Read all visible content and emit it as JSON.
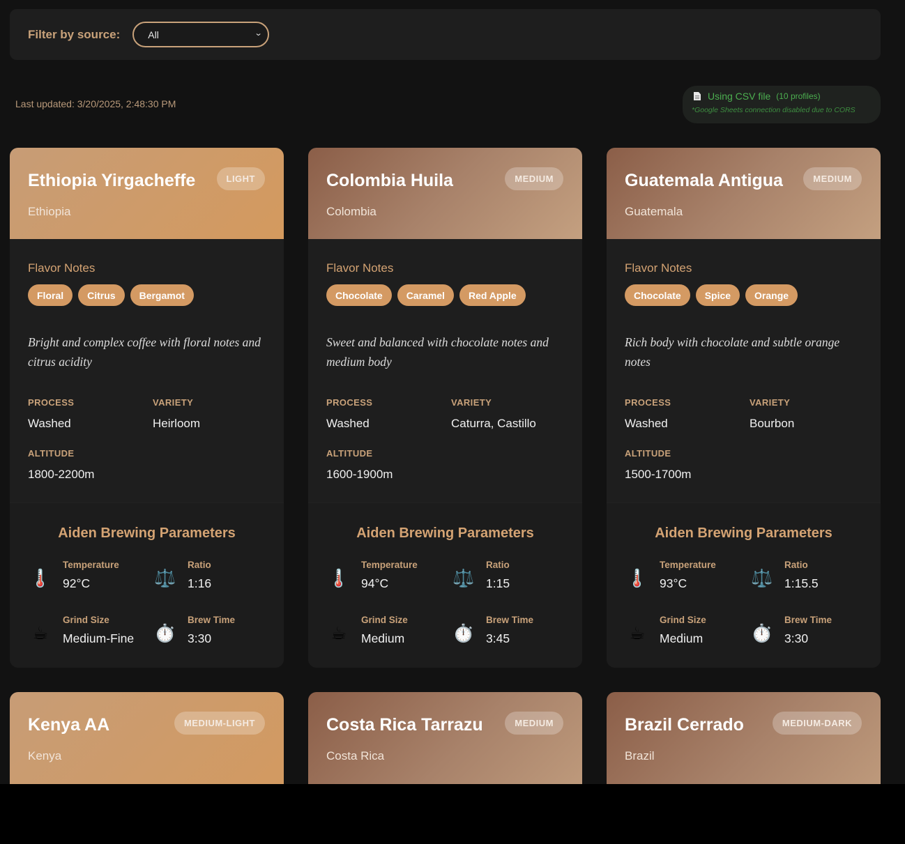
{
  "filter": {
    "label": "Filter by source:",
    "selected": "All"
  },
  "last_updated": "Last updated: 3/20/2025, 2:48:30 PM",
  "status": {
    "main": "Using CSV file",
    "count": "(10 profiles)",
    "note": "*Google Sheets connection disabled due to CORS"
  },
  "labels": {
    "flavor_notes": "Flavor Notes",
    "process": "PROCESS",
    "variety": "VARIETY",
    "altitude": "ALTITUDE",
    "brewing_title": "Aiden Brewing Parameters",
    "temperature": "Temperature",
    "ratio": "Ratio",
    "grind_size": "Grind Size",
    "brew_time": "Brew Time"
  },
  "cards": [
    {
      "name": "Ethiopia Yirgacheffe",
      "country": "Ethiopia",
      "roast": "LIGHT",
      "flavors": [
        "Floral",
        "Citrus",
        "Bergamot"
      ],
      "description": "Bright and complex coffee with floral notes and citrus acidity",
      "process": "Washed",
      "variety": "Heirloom",
      "altitude": "1800-2200m",
      "temperature": "92°C",
      "ratio": "1:16",
      "grind": "Medium-Fine",
      "time": "3:30"
    },
    {
      "name": "Colombia Huila",
      "country": "Colombia",
      "roast": "MEDIUM",
      "flavors": [
        "Chocolate",
        "Caramel",
        "Red Apple"
      ],
      "description": "Sweet and balanced with chocolate notes and medium body",
      "process": "Washed",
      "variety": "Caturra, Castillo",
      "altitude": "1600-1900m",
      "temperature": "94°C",
      "ratio": "1:15",
      "grind": "Medium",
      "time": "3:45"
    },
    {
      "name": "Guatemala Antigua",
      "country": "Guatemala",
      "roast": "MEDIUM",
      "flavors": [
        "Chocolate",
        "Spice",
        "Orange"
      ],
      "description": "Rich body with chocolate and subtle orange notes",
      "process": "Washed",
      "variety": "Bourbon",
      "altitude": "1500-1700m",
      "temperature": "93°C",
      "ratio": "1:15.5",
      "grind": "Medium",
      "time": "3:30"
    },
    {
      "name": "Kenya AA",
      "country": "Kenya",
      "roast": "MEDIUM-LIGHT"
    },
    {
      "name": "Costa Rica Tarrazu",
      "country": "Costa Rica",
      "roast": "MEDIUM"
    },
    {
      "name": "Brazil Cerrado",
      "country": "Brazil",
      "roast": "MEDIUM-DARK"
    }
  ]
}
